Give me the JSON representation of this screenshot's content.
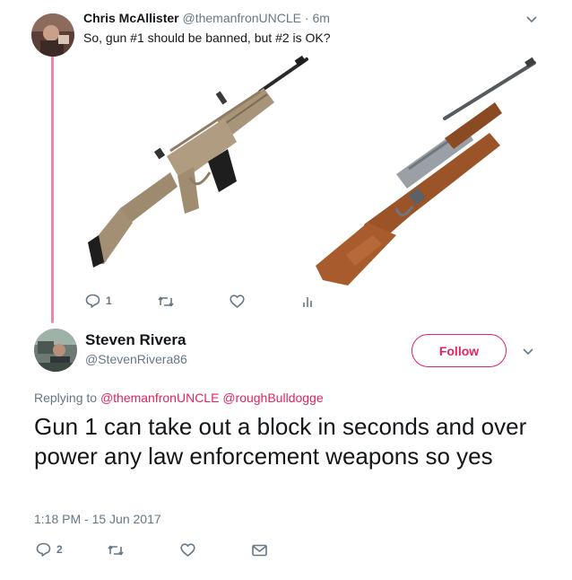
{
  "parent_tweet": {
    "name": "Chris McAllister",
    "handle": "@themanfronUNCLE",
    "separator": "·",
    "time": "6m",
    "text": "So, gun #1 should be banned, but #2 is OK?",
    "images": [
      {
        "alt": "tan tactical rifle with folding stock",
        "icon": "tactical-rifle"
      },
      {
        "alt": "wood-stock ranch rifle",
        "icon": "ranch-rifle"
      }
    ],
    "actions": {
      "reply_count": "1",
      "retweet_count": "",
      "like_count": ""
    }
  },
  "main_tweet": {
    "name": "Steven Rivera",
    "handle": "@StevenRivera86",
    "follow_label": "Follow",
    "replying_label": "Replying to",
    "mentions": [
      "@themanfronUNCLE",
      "@roughBulldogge"
    ],
    "text": "Gun 1 can take out a block in seconds and over power any law enforcement weapons so yes",
    "timestamp": "1:18 PM - 15 Jun 2017",
    "actions": {
      "reply_count": "2",
      "retweet_count": "",
      "like_count": ""
    }
  },
  "colors": {
    "accent": "#e0245e",
    "muted": "#657786",
    "text": "#14171a",
    "thread_line": "#e0245e"
  }
}
